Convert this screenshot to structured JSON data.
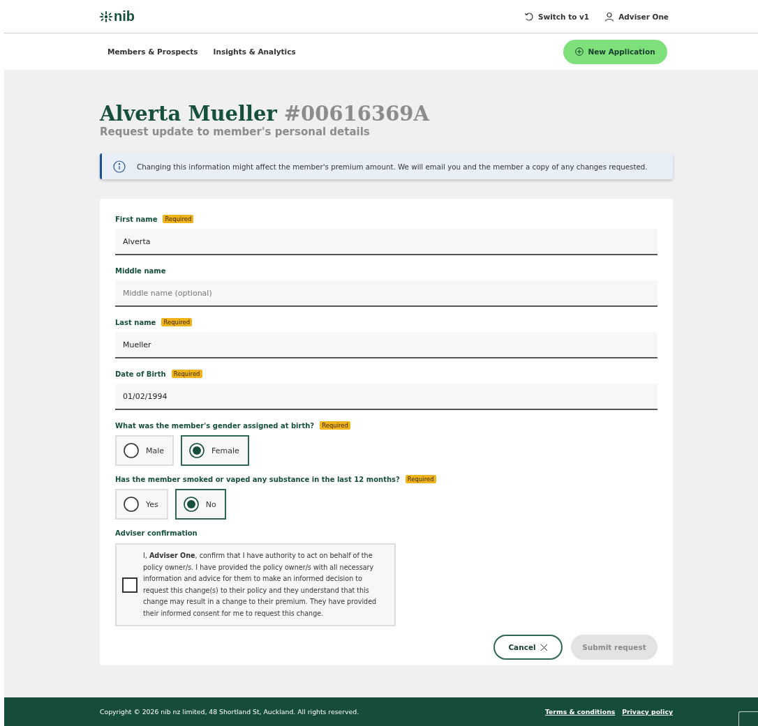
{
  "header": {
    "logo": "nib",
    "switch_link": "Switch to v1",
    "user": "Adviser One"
  },
  "nav": {
    "items": [
      {
        "label": "Members & Prospects"
      },
      {
        "label": "Insights & Analytics"
      }
    ],
    "new_button": "New Application"
  },
  "title": {
    "name": "Alverta Mueller",
    "number": "#00616369A",
    "subtitle": "Request update to member's personal details"
  },
  "info": "Changing this information might affect the member's premium amount. We will email you and the member a copy of any changes requested.",
  "fields": [
    {
      "kind": "text",
      "label": "First name",
      "badge": "Required",
      "value": "Alverta"
    },
    {
      "kind": "text",
      "label": "Middle name",
      "placeholder": "Middle name (optional)"
    },
    {
      "kind": "text",
      "label": "Last name",
      "badge": "Required",
      "value": "Mueller"
    },
    {
      "kind": "text",
      "label": "Date of Birth",
      "badge": "Required",
      "value": "01/02/1994"
    },
    {
      "kind": "radio",
      "label": "What was the member's gender assigned at birth?",
      "badge": "Required",
      "options": [
        {
          "label": "Male",
          "selected": false
        },
        {
          "label": "Female",
          "selected": true
        }
      ]
    },
    {
      "kind": "radio",
      "label": "Has the member smoked or vaped any substance in the last 12 months?",
      "badge": "Required",
      "options": [
        {
          "label": "Yes",
          "selected": false
        },
        {
          "label": "No",
          "selected": true
        }
      ]
    },
    {
      "kind": "checkbox",
      "label": "Adviser confirmation",
      "text": "I, **Adviser One**, confirm that I have authority to act on behalf of the policy owner/s. I have provided the policy owner/s with all necessary information and advice for them to make an informed decision to request this change(s) to their policy and they understand that this change may result in a change to their premium. They have provided their informed consent for me to request this change.",
      "checked": false
    }
  ],
  "actions": {
    "cancel": "Cancel",
    "submit": "Submit request",
    "submit_disabled": true
  },
  "footer": {
    "copyright": "Copyright © 2026 nib nz limited, 48 Shortland St, Auckland. All rights reserved.",
    "links": [
      "Terms & conditions",
      "Privacy policy"
    ]
  }
}
